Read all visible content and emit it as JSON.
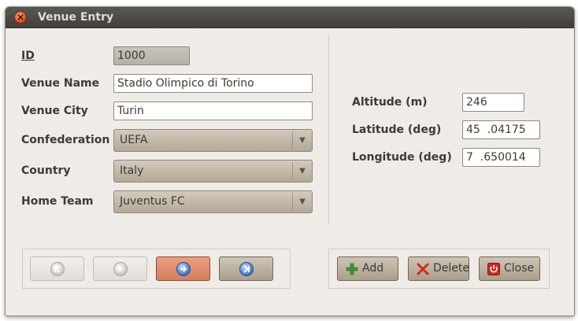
{
  "window": {
    "title": "Venue Entry"
  },
  "left_labels": {
    "id": "ID",
    "venue_name": "Venue Name",
    "venue_city": "Venue City",
    "confederation": "Confederation",
    "country": "Country",
    "home_team": "Home Team"
  },
  "fields": {
    "id": "1000",
    "venue_name": "Stadio Olimpico di Torino",
    "venue_city": "Turin",
    "confederation": "UEFA",
    "country": "Italy",
    "home_team": "Juventus FC"
  },
  "right_labels": {
    "altitude": "Altitude (m)",
    "latitude": "Latitude (deg)",
    "longitude": "Longitude (deg)"
  },
  "right_fields": {
    "altitude": "246",
    "latitude": "45  .04175",
    "longitude": "7  .650014"
  },
  "actions": {
    "add": "Add",
    "delete": "Delete",
    "close": "Close"
  },
  "icons": {
    "window_close": "close-icon",
    "first": "first-record-icon",
    "previous": "previous-record-icon",
    "next": "next-record-icon",
    "last": "last-record-icon",
    "add": "plus-icon",
    "delete": "delete-x-icon",
    "close": "power-icon"
  },
  "colors": {
    "titlebar": "#3e3d39",
    "window_bg": "#efebe7",
    "next_button": "#e1906f",
    "close_accent": "#dd4814"
  }
}
